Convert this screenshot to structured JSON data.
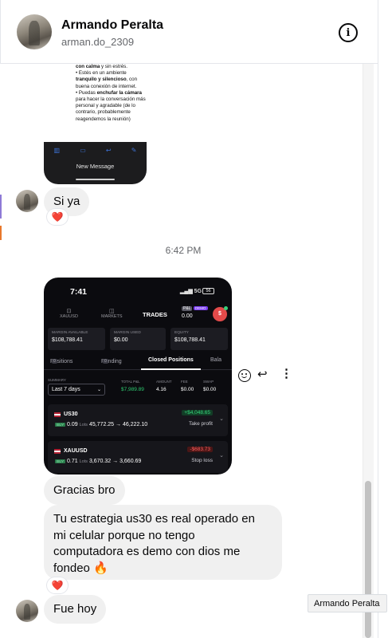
{
  "header": {
    "name": "Armando Peralta",
    "username": "arman.do_2309"
  },
  "shared_note": {
    "lines": [
      [
        "con calma",
        " y sin estrés."
      ],
      [
        "• Estés en un ambiente"
      ],
      [
        "tranquilo y silencioso",
        ", con"
      ],
      [
        "buena conexión de internet."
      ],
      [
        "• Puedas ",
        "enchufar la cámara"
      ],
      [
        "para hacer la conversación más"
      ],
      [
        "personal y agradable (de lo"
      ],
      [
        "contrario, probablemente"
      ],
      [
        "reagendemos la reunión)"
      ]
    ],
    "new_message_label": "New Message"
  },
  "messages": {
    "m1": "Si ya",
    "timestamp": "6:42 PM",
    "m2": "Gracias bro",
    "m3_lines": [
      "Tu estrategia us30 es real operado en",
      "mi celular porque no tengo",
      "computadora es demo con dios me",
      "fondeo 🔥"
    ],
    "m4": "Fue hoy",
    "reaction": "❤️"
  },
  "trade_app": {
    "clock": "7:41",
    "signal": "5G",
    "battery": "56",
    "nav": [
      {
        "label": "XAUUSD",
        "icon": "chart-icon"
      },
      {
        "label": "MARKETS",
        "icon": "markets-icon"
      }
    ],
    "nav_active": "TRADES",
    "pnl_badge": "P&L",
    "demo_badge": "DEMO",
    "pnl_value": "0.00",
    "avatar_letter": "$",
    "metrics": [
      {
        "label": "MARGIN AVAILABLE",
        "value": "$108,788.41"
      },
      {
        "label": "MARGIN USED",
        "value": "$0.00"
      },
      {
        "label": "EQUITY",
        "value": "$108,788.41"
      }
    ],
    "tabs": {
      "positions": "Positions",
      "positions_count": "0",
      "pending": "Pending",
      "pending_count": "0",
      "closed": "Closed Positions",
      "balance": "Bala"
    },
    "summary": {
      "label": "SUMMARY",
      "period": "Last 7 days",
      "total_pnl_label": "TOTAL P&L",
      "total_pnl": "$7,989.89",
      "amount_label": "AMOUNT",
      "amount": "4.16",
      "fee_label": "FEE",
      "fee": "$0.00",
      "swap_label": "SWAP",
      "swap": "$0.00"
    },
    "trades": [
      {
        "symbol": "US30",
        "side": "BUY",
        "lots": "0.09",
        "lots_label": "Lots",
        "open": "45,772.25",
        "close": "46,222.10",
        "pnl": "+$4,048.65",
        "reason": "Take profit",
        "positive": true
      },
      {
        "symbol": "XAUUSD",
        "side": "BUY",
        "lots": "0.71",
        "lots_label": "Lots",
        "open": "3,670.32",
        "close": "3,660.69",
        "pnl": "-$683.73",
        "reason": "Stop loss",
        "positive": false
      }
    ]
  },
  "tooltip": "Armando Peralta",
  "icons": {
    "info": "info-icon",
    "react": "smile-icon",
    "reply": "reply-icon",
    "more": "more-icon"
  },
  "colors": {
    "bubble": "#f0f0f0",
    "heart": "#e41e3f",
    "profit": "#36d57b",
    "loss": "#ff5d5d"
  }
}
